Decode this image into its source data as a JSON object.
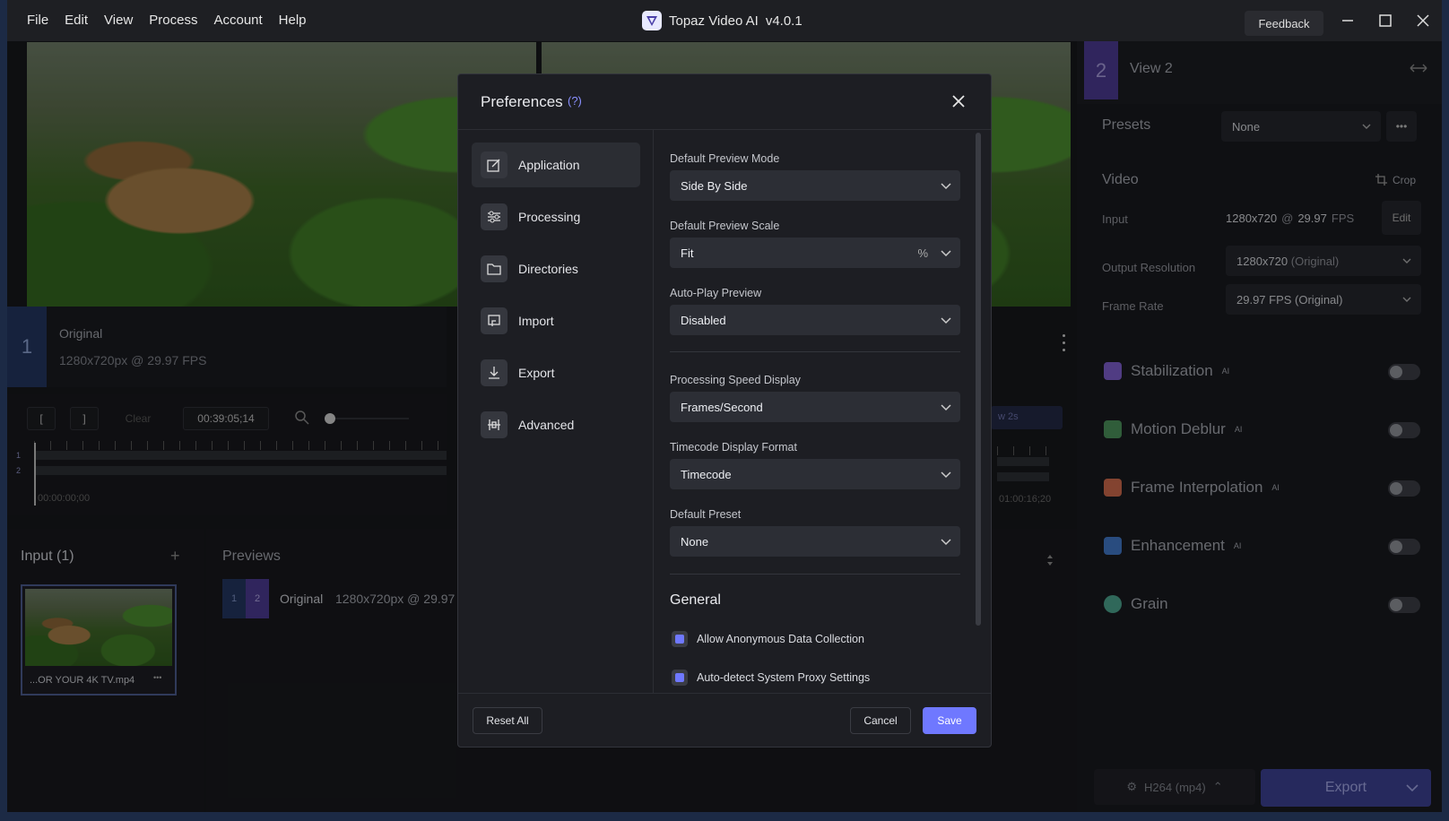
{
  "menu": [
    "File",
    "Edit",
    "View",
    "Process",
    "Account",
    "Help"
  ],
  "app": {
    "title": "Topaz Video AI",
    "version": "v4.0.1",
    "feedback": "Feedback"
  },
  "view1": {
    "number": "1",
    "label": "Original",
    "info": "1280x720px @ 29.97 FPS"
  },
  "timeline": {
    "in": "[",
    "out": "]",
    "clear": "Clear",
    "timecode": "00:39:05;14",
    "start": "00:00:00;00",
    "end": "01:00:16;20",
    "track1": "1",
    "track2": "2",
    "preview_btn": "w 2s"
  },
  "input": {
    "title": "Input (1)",
    "add": "+",
    "file": "...OR YOUR 4K TV.mp4",
    "more": "•••"
  },
  "previews": {
    "title": "Previews",
    "b1": "1",
    "b2": "2",
    "name": "Original",
    "info": "1280x720px @ 29.97"
  },
  "right": {
    "view_number": "2",
    "view_label": "View 2",
    "presets_label": "Presets",
    "presets_value": "None",
    "video_label": "Video",
    "crop": "Crop",
    "input_label": "Input",
    "input_res": "1280x720",
    "input_at": "@",
    "input_fps": "29.97",
    "input_fps_unit": "FPS",
    "edit": "Edit",
    "outres_label": "Output Resolution",
    "outres_value": "1280x720",
    "outres_suffix": "(Original)",
    "framerate_label": "Frame Rate",
    "framerate_value": "29.97 FPS (Original)",
    "features": [
      {
        "name": "Stabilization",
        "ai": "AI",
        "color": "#7b5cc9"
      },
      {
        "name": "Motion Deblur",
        "ai": "AI",
        "color": "#4a8f5a"
      },
      {
        "name": "Frame Interpolation",
        "ai": "AI",
        "color": "#c9684a"
      },
      {
        "name": "Enhancement",
        "ai": "AI",
        "color": "#3f76c4"
      },
      {
        "name": "Grain",
        "ai": "",
        "color": "#4aa08a"
      }
    ],
    "codec": "H264 (mp4)",
    "export": "Export"
  },
  "prefs": {
    "title": "Preferences",
    "help": "(?)",
    "nav": [
      "Application",
      "Processing",
      "Directories",
      "Import",
      "Export",
      "Advanced"
    ],
    "fields": [
      {
        "label": "Default Preview Mode",
        "value": "Side By Side"
      },
      {
        "label": "Default Preview Scale",
        "value": "Fit",
        "unit": "%"
      },
      {
        "label": "Auto-Play Preview",
        "value": "Disabled"
      },
      {
        "label": "Processing Speed Display",
        "value": "Frames/Second"
      },
      {
        "label": "Timecode Display Format",
        "value": "Timecode"
      },
      {
        "label": "Default Preset",
        "value": "None"
      }
    ],
    "general_title": "General",
    "checks": [
      "Allow Anonymous Data Collection",
      "Auto-detect System Proxy Settings"
    ],
    "reset": "Reset All",
    "cancel": "Cancel",
    "save": "Save"
  },
  "colors": {
    "accent": "#6f78ff",
    "view1": "#23355e",
    "view2": "#4b3a8f"
  }
}
